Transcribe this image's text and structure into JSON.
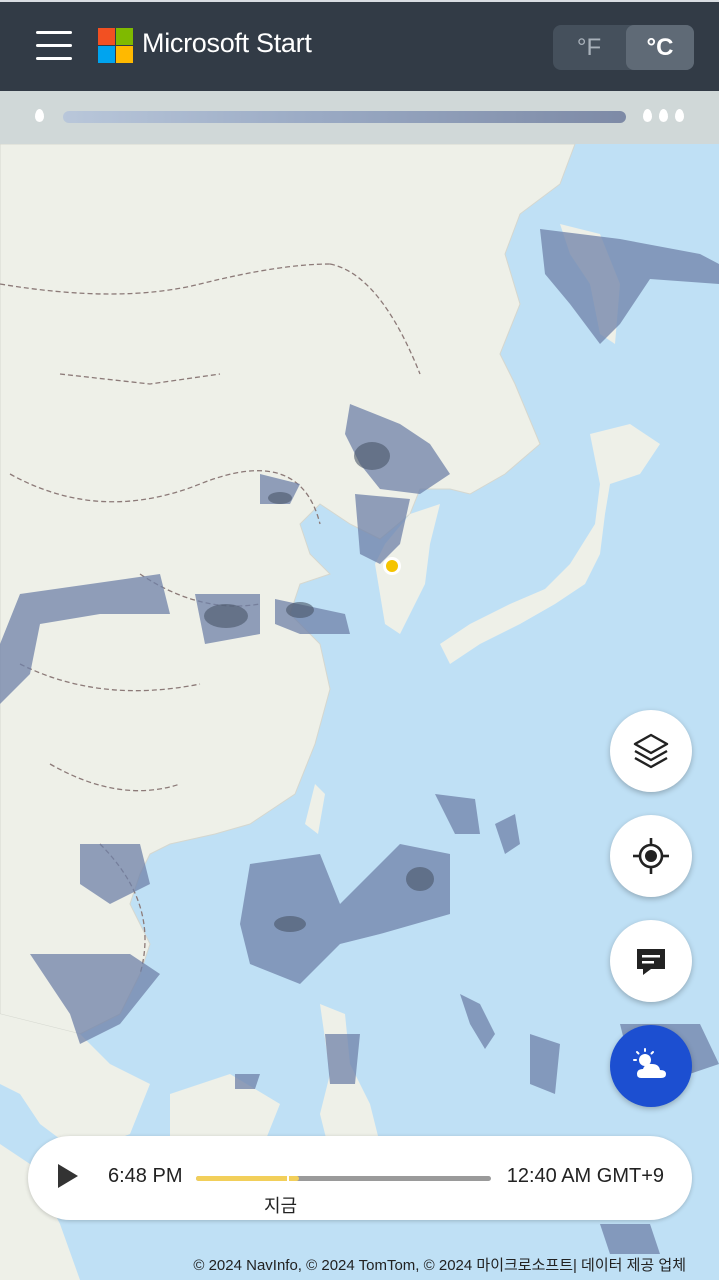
{
  "header": {
    "brand": "Microsoft Start",
    "units": {
      "fahrenheit": "°F",
      "celsius": "°C",
      "selected": "°C"
    },
    "logo_colors": [
      "#f25022",
      "#7fba00",
      "#00a4ef",
      "#ffb900"
    ]
  },
  "legend": {
    "low_icon": "drop-icon",
    "high_icon": "three-drops-icon"
  },
  "map": {
    "location_marker_color": "#f5c400",
    "precip_color": "#6f82a8"
  },
  "controls": {
    "layers_icon": "layers-icon",
    "locate_icon": "crosshair-icon",
    "feedback_icon": "message-icon",
    "weather_icon": "partly-cloudy-icon"
  },
  "timeline": {
    "start_time": "6:48 PM",
    "end_time": "12:40 AM GMT+9",
    "now_label": "지금",
    "progress": 0.35,
    "now_position": 0.31
  },
  "attribution": "© 2024 NavInfo, © 2024 TomTom, © 2024 마이크로소프트| 데이터 제공 업체"
}
